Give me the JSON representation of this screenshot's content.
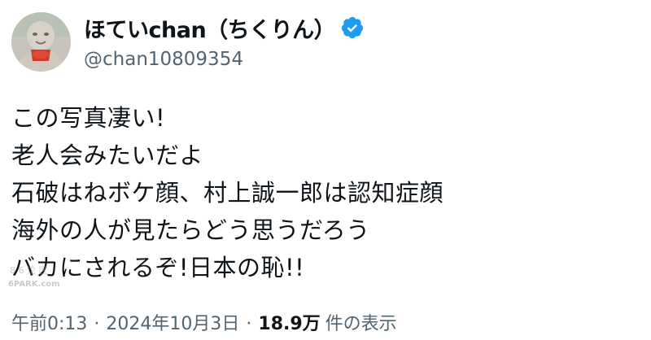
{
  "user": {
    "display_name": "ほていchan（ちくりん）",
    "handle": "@chan10809354",
    "verified_color": "#1d9bf0"
  },
  "tweet": {
    "lines": [
      "この写真凄い!",
      "老人会みたいだよ",
      "石破はねボケ顔、村上誠一郎は認知症顔",
      "海外の人が見たらどう思うだろう",
      "バカにされるぞ!日本の恥!!"
    ]
  },
  "meta": {
    "time": "午前0:13",
    "separator": "·",
    "date": "2024年10月3日",
    "views_count": "18.9万",
    "views_label": "件の表示"
  },
  "watermark": {
    "text_top": "8 6 论 区",
    "text_bottom": "6PARK.com"
  },
  "icons": {
    "avatar": "avatar-image",
    "verified": "verified-badge-icon"
  }
}
